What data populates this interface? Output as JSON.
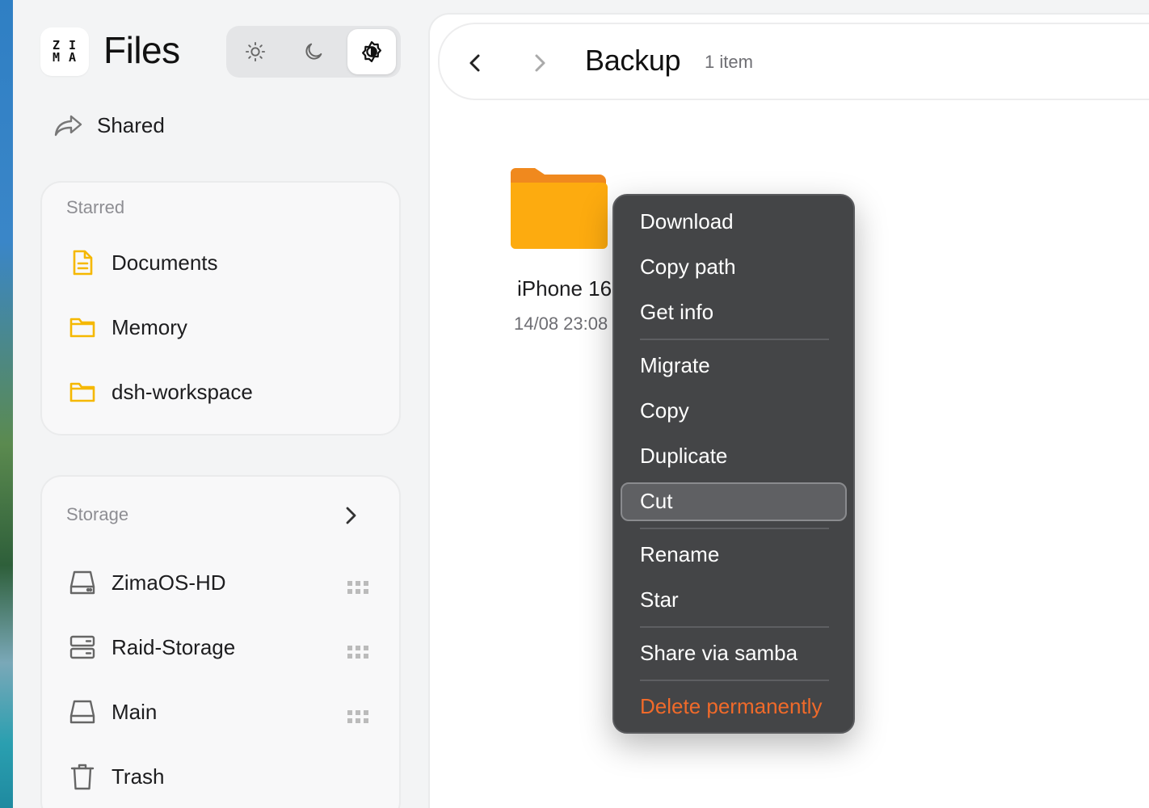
{
  "app": {
    "logo_text": "ZIMA",
    "title": "Files"
  },
  "theme_switch": {
    "options": [
      {
        "name": "light",
        "icon": "sun-icon"
      },
      {
        "name": "dark",
        "icon": "moon-icon"
      },
      {
        "name": "auto",
        "icon": "auto-theme-icon",
        "active": true
      }
    ]
  },
  "sidebar": {
    "shared_label": "Shared",
    "starred": {
      "header": "Starred",
      "items": [
        {
          "label": "Documents",
          "icon": "document-icon"
        },
        {
          "label": "Memory",
          "icon": "folder-icon"
        },
        {
          "label": "dsh-workspace",
          "icon": "folder-icon"
        }
      ]
    },
    "storage": {
      "header": "Storage",
      "items": [
        {
          "label": "ZimaOS-HD",
          "icon": "drive-icon"
        },
        {
          "label": "Raid-Storage",
          "icon": "raid-icon"
        },
        {
          "label": "Main",
          "icon": "drive-icon"
        },
        {
          "label": "Trash",
          "icon": "trash-icon"
        }
      ]
    }
  },
  "main": {
    "folder_title": "Backup",
    "item_count": "1 item",
    "files": [
      {
        "name": "iPhone 16",
        "date": "14/08 23:08",
        "icon": "folder-icon"
      }
    ]
  },
  "context_menu": {
    "items": [
      {
        "label": "Download"
      },
      {
        "label": "Copy path"
      },
      {
        "label": "Get info"
      },
      {
        "label": "Migrate"
      },
      {
        "label": "Copy"
      },
      {
        "label": "Duplicate"
      },
      {
        "label": "Cut",
        "highlighted": true
      },
      {
        "label": "Rename"
      },
      {
        "label": "Star"
      },
      {
        "label": "Share via samba"
      },
      {
        "label": "Delete permanently",
        "danger": true
      }
    ]
  },
  "colors": {
    "accent_folder": "#fdab0f",
    "danger": "#f06a2a",
    "menu_bg": "#444547"
  }
}
